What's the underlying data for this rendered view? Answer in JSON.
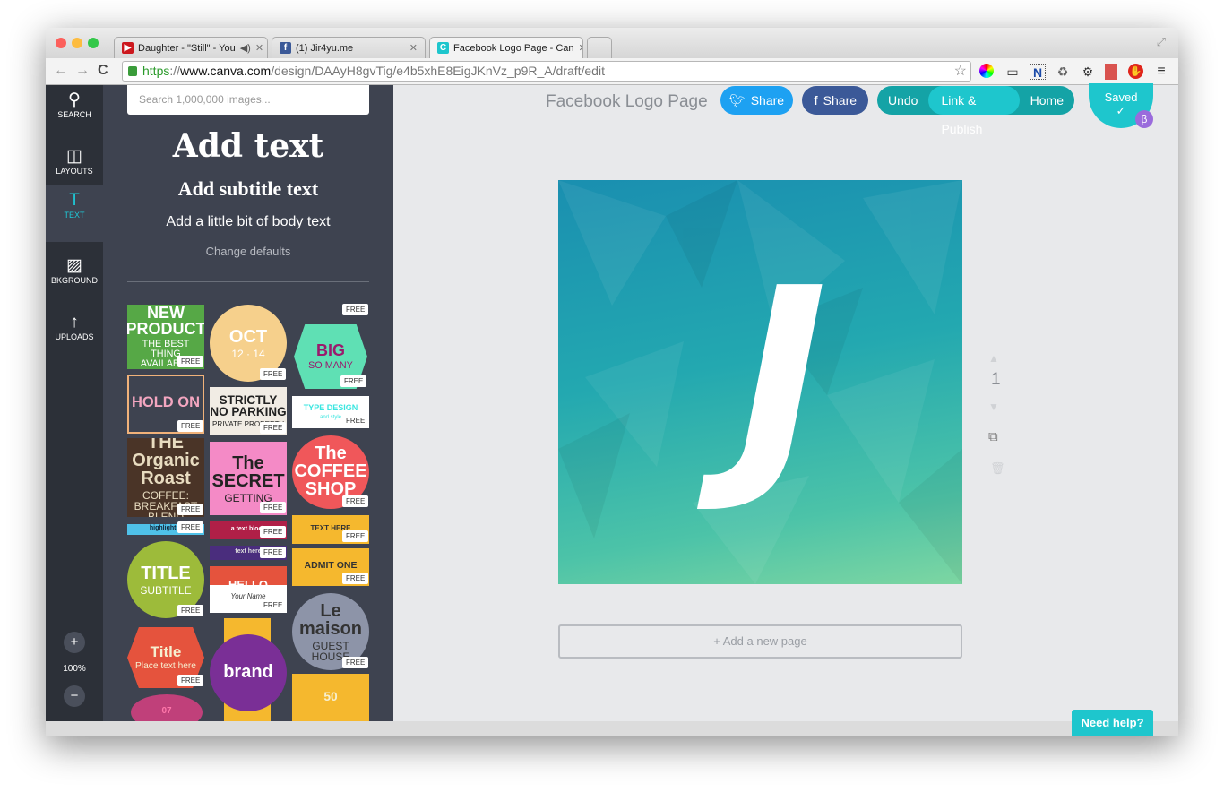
{
  "browser": {
    "tabs": [
      {
        "title": "Daughter - \"Still\" - You",
        "icon": "youtube-icon",
        "color": "#cc181e"
      },
      {
        "title": "(1) Jir4yu.me",
        "icon": "facebook-icon",
        "color": "#3b5998"
      },
      {
        "title": "Facebook Logo Page - Can",
        "icon": "canva-icon",
        "color": "#1ec6cd"
      }
    ],
    "url_scheme": "https",
    "url_sep": "://",
    "url_host": "www.canva.com",
    "url_path": "/design/DAAyH8gvTig/e4b5xhE8EigJKnVz_p9R_A/draft/edit",
    "extensions": [
      "color-wheel-icon",
      "ruler-icon",
      "onenote-clipper-icon",
      "recycle-icon",
      "gear-icon",
      "book-icon",
      "adblock-icon",
      "menu-icon"
    ]
  },
  "rail": {
    "items": [
      {
        "label": "SEARCH",
        "icon": "search-icon"
      },
      {
        "label": "LAYOUTS",
        "icon": "layouts-icon"
      },
      {
        "label": "TEXT",
        "icon": "text-icon"
      },
      {
        "label": "BKGROUND",
        "icon": "background-icon"
      },
      {
        "label": "UPLOADS",
        "icon": "upload-icon"
      }
    ],
    "zoom": "100%"
  },
  "panel": {
    "search_placeholder": "Search 1,000,000 images...",
    "add_text": "Add text",
    "add_subtitle": "Add subtitle text",
    "add_body": "Add a little bit of body text",
    "change_defaults": "Change defaults",
    "free": "FREE",
    "templates": [
      {
        "l1": "NEW PRODUCT",
        "l2": "THE BEST THING AVAILABLE",
        "bg": "#56a846"
      },
      {
        "l1": "OCT",
        "l2": "12 · 14",
        "bg": "#f6d08c"
      },
      {
        "l1": "",
        "l2": "",
        "bg": "#3e4350"
      },
      {
        "l1": "BIG",
        "l2": "SO MANY",
        "bg": "#5fe0b4"
      },
      {
        "l1": "HOLD ON",
        "l2": "",
        "bg": "#3e4350"
      },
      {
        "l1": "STRICTLY NO PARKING",
        "l2": "PRIVATE PROPERTY",
        "bg": "#f1ece4"
      },
      {
        "l1": "TYPE DESIGN",
        "l2": "and style",
        "bg": "#ffffff"
      },
      {
        "l1": "THE Organic Roast",
        "l2": "COFFEE: BREAKFAST BLEND",
        "bg": "#4a3427"
      },
      {
        "l1": "The SECRET",
        "l2": "GETTING",
        "bg": "#f48ac6"
      },
      {
        "l1": "The COFFEE SHOP",
        "l2": "",
        "bg": "#f0575a"
      },
      {
        "l1": "highlighter",
        "l2": "",
        "bg": "#4fc1e9"
      },
      {
        "l1": "a text block",
        "l2": "",
        "bg": "#b01f47"
      },
      {
        "l1": "text here",
        "l2": "",
        "bg": "#4a2d7d"
      },
      {
        "l1": "TEXT HERE",
        "l2": "",
        "bg": "#f5b82e"
      },
      {
        "l1": "HELLO",
        "l2": "Your Name",
        "bg": "#e5533d"
      },
      {
        "l1": "ADMIT ONE",
        "l2": "",
        "bg": "#f5b82e"
      },
      {
        "l1": "TITLE",
        "l2": "SUBTITLE",
        "bg": "#9dbb3a"
      },
      {
        "l1": "Le maison",
        "l2": "GUEST HOUSE",
        "bg": "#8d94a8"
      },
      {
        "l1": "Title",
        "l2": "Place text here",
        "bg": "#e5533d"
      },
      {
        "l1": "brand",
        "l2": "",
        "bg": "#7a2f96"
      },
      {
        "l1": "50",
        "l2": "",
        "bg": "#f5b82e"
      },
      {
        "l1": "07",
        "l2": "",
        "bg": "#c0407a"
      }
    ]
  },
  "header": {
    "title": "Facebook Logo Page",
    "twitter_share": "Share",
    "facebook_share": "Share",
    "undo": "Undo",
    "link_publish": "Link & Publish",
    "home": "Home",
    "saved": "Saved",
    "saved_check": "✓",
    "beta": "β"
  },
  "canvas": {
    "letter": "J",
    "page_number": "1",
    "add_page": "+ Add a new page"
  },
  "help": "Need help?"
}
